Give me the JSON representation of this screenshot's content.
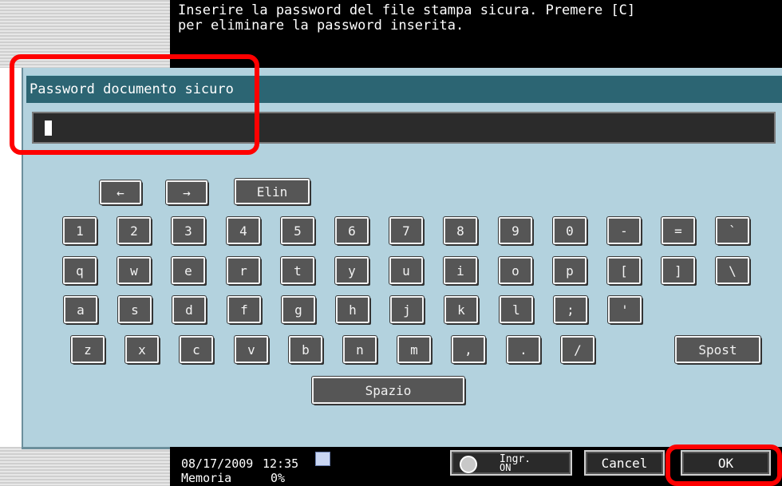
{
  "header": {
    "message": "Inserire la password del file stampa sicura. Premere [C]\nper eliminare la password inserita."
  },
  "input": {
    "label": "Password documento sicuro",
    "value": ""
  },
  "keyboard": {
    "left_arrow": "←",
    "right_arrow": "→",
    "delete_label": "Elin",
    "row1": [
      "1",
      "2",
      "3",
      "4",
      "5",
      "6",
      "7",
      "8",
      "9",
      "0",
      "-",
      "=",
      "`"
    ],
    "row2": [
      "q",
      "w",
      "e",
      "r",
      "t",
      "y",
      "u",
      "i",
      "o",
      "p",
      "[",
      "]",
      "\\"
    ],
    "row3": [
      "a",
      "s",
      "d",
      "f",
      "g",
      "h",
      "j",
      "k",
      "l",
      ";",
      "'"
    ],
    "row4": [
      "z",
      "x",
      "c",
      "v",
      "b",
      "n",
      "m",
      ",",
      ".",
      "/"
    ],
    "shift_label": "Spost",
    "space_label": "Spazio"
  },
  "footer": {
    "date": "08/17/2009",
    "time": "12:35",
    "memory_label": "Memoria",
    "memory_value": "0%",
    "enlarge_label": "Ingr.",
    "enlarge_sub": "ON",
    "cancel_label": "Cancel",
    "ok_label": "OK"
  },
  "colors": {
    "panel": "#b3d2de",
    "titlebar": "#2c6573",
    "key": "#565656",
    "highlight": "#ff0000"
  }
}
